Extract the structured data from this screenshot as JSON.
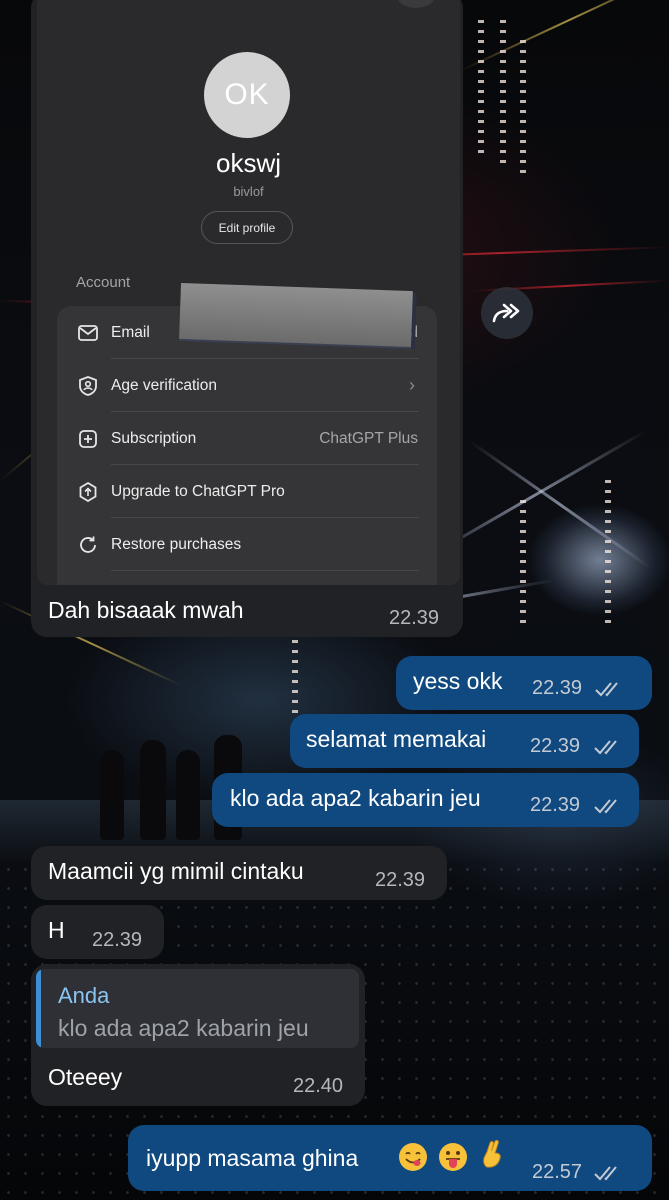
{
  "screenshot": {
    "avatar_initials": "OK",
    "display_name": "okswj",
    "username": "bivlof",
    "edit_profile_label": "Edit profile",
    "section_label": "Account",
    "rows": [
      {
        "label": "Email",
        "value": "d",
        "icon": "mail-icon"
      },
      {
        "label": "Age verification",
        "value": "›",
        "icon": "shield-person-icon"
      },
      {
        "label": "Subscription",
        "value": "ChatGPT Plus",
        "icon": "plus-square-icon"
      },
      {
        "label": "Upgrade to ChatGPT Pro",
        "value": "",
        "icon": "upgrade-badge-icon"
      },
      {
        "label": "Restore purchases",
        "value": "",
        "icon": "refresh-icon"
      }
    ]
  },
  "messages": [
    {
      "dir": "in",
      "text": "Dah bisaaak mwah",
      "time": "22.39"
    },
    {
      "dir": "out",
      "text": "yess okk",
      "time": "22.39",
      "status": "read"
    },
    {
      "dir": "out",
      "text": "selamat memakai",
      "time": "22.39",
      "status": "read"
    },
    {
      "dir": "out",
      "text": "klo ada apa2 kabarin jeu",
      "time": "22.39",
      "status": "read"
    },
    {
      "dir": "in",
      "text": "Maamcii yg mimil cintaku",
      "time": "22.39"
    },
    {
      "dir": "in",
      "text": "H",
      "time": "22.39"
    },
    {
      "dir": "in",
      "text": "Oteeey",
      "time": "22.40",
      "reply_to": {
        "name": "Anda",
        "text": "klo ada apa2 kabarin jeu"
      }
    },
    {
      "dir": "out",
      "text": "iyupp masama ghina",
      "time": "22.57",
      "status": "read",
      "emojis": [
        "savoring-face-emoji",
        "tongue-face-emoji",
        "crossed-fingers-emoji"
      ]
    }
  ],
  "colors": {
    "outgoing_bubble": "#10497f",
    "incoming_bubble": "#212226",
    "reply_accent": "#3d8fd6"
  }
}
